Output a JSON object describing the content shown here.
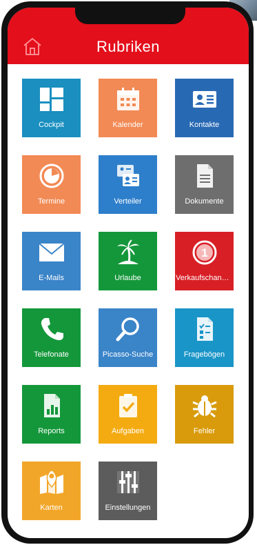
{
  "header": {
    "title": "Rubriken",
    "background": "#e30f1b",
    "home_icon": "home-icon"
  },
  "tiles": [
    {
      "label": "Cockpit",
      "color": "#1a8fc0",
      "icon": "dashboard-icon"
    },
    {
      "label": "Kalender",
      "color": "#f28a55",
      "icon": "calendar-icon"
    },
    {
      "label": "Kontakte",
      "color": "#2869b4",
      "icon": "contact-card-icon"
    },
    {
      "label": "Termine",
      "color": "#f28a55",
      "icon": "clock-icon"
    },
    {
      "label": "Verteiler",
      "color": "#2e7fcb",
      "icon": "distribution-list-icon"
    },
    {
      "label": "Dokumente",
      "color": "#6e6e6e",
      "icon": "document-icon"
    },
    {
      "label": "E-Mails",
      "color": "#3a84c8",
      "icon": "envelope-icon"
    },
    {
      "label": "Urlaube",
      "color": "#14973a",
      "icon": "palm-tree-icon"
    },
    {
      "label": "Verkaufschancen",
      "color": "#d81f26",
      "icon": "sales-opportunity-icon"
    },
    {
      "label": "Telefonate",
      "color": "#14973a",
      "icon": "phone-icon"
    },
    {
      "label": "Picasso-Suche",
      "color": "#3a84c8",
      "icon": "search-icon"
    },
    {
      "label": "Fragebögen",
      "color": "#1a95c8",
      "icon": "questionnaire-icon"
    },
    {
      "label": "Reports",
      "color": "#14973a",
      "icon": "report-icon"
    },
    {
      "label": "Aufgaben",
      "color": "#f4ab12",
      "icon": "clipboard-check-icon"
    },
    {
      "label": "Fehler",
      "color": "#d99b0b",
      "icon": "bug-icon"
    },
    {
      "label": "Karten",
      "color": "#f2a629",
      "icon": "map-icon"
    },
    {
      "label": "Einstellungen",
      "color": "#5c5c5c",
      "icon": "sliders-icon"
    }
  ],
  "badges": {
    "sales_opportunity_count": "1"
  }
}
